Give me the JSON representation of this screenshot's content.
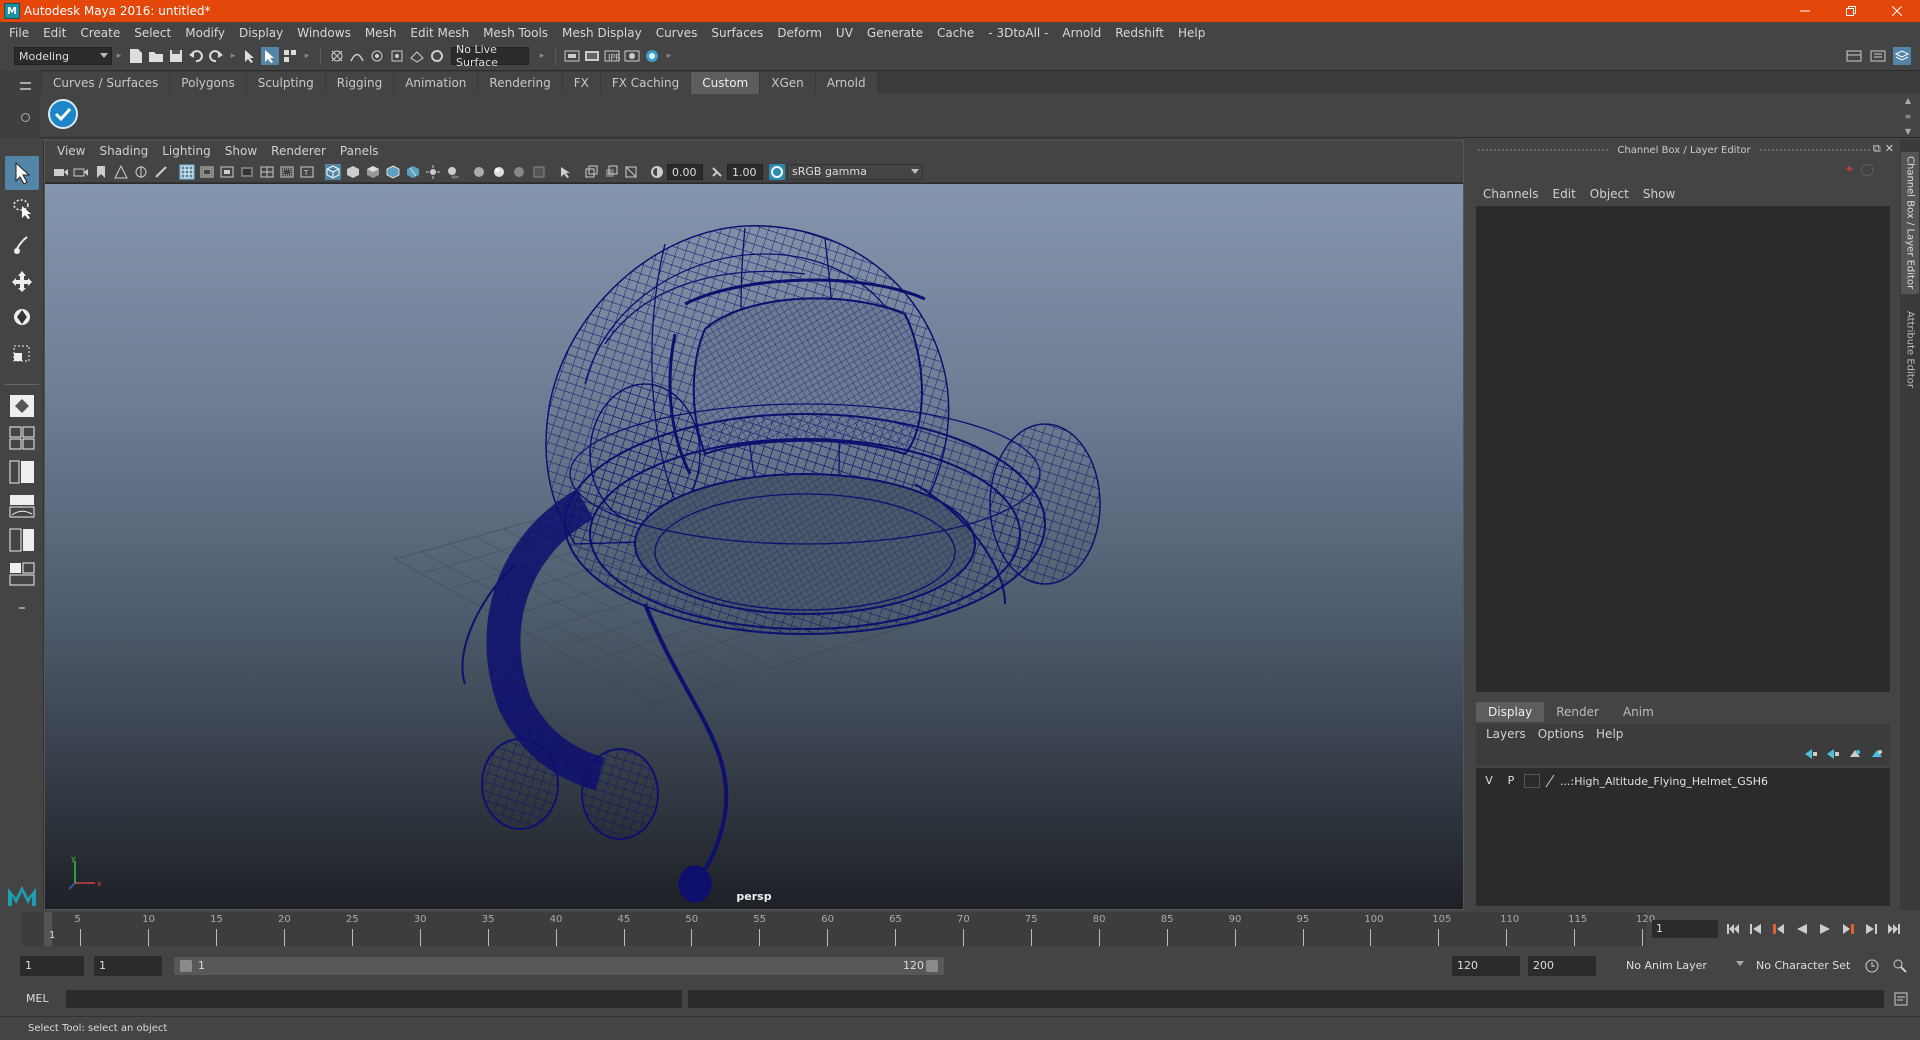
{
  "window": {
    "title": "Autodesk Maya 2016: untitled*",
    "app_icon": "maya-icon",
    "controls": [
      "minimize-icon",
      "restore-icon",
      "close-icon"
    ]
  },
  "menubar": {
    "items": [
      "File",
      "Edit",
      "Create",
      "Select",
      "Modify",
      "Display",
      "Windows",
      "Mesh",
      "Edit Mesh",
      "Mesh Tools",
      "Mesh Display",
      "Curves",
      "Surfaces",
      "Deform",
      "UV",
      "Generate",
      "Cache",
      "- 3DtoAll -",
      "Arnold",
      "Redshift",
      "Help"
    ]
  },
  "statusline": {
    "menuset": "Modeling",
    "live_surface": "No Live Surface"
  },
  "shelf": {
    "tabs": [
      "Curves / Surfaces",
      "Polygons",
      "Sculpting",
      "Rigging",
      "Animation",
      "Rendering",
      "FX",
      "FX Caching",
      "Custom",
      "XGen",
      "Arnold"
    ],
    "active_tab": "Custom",
    "button_icon": "checkmark-icon"
  },
  "viewport": {
    "menu": [
      "View",
      "Shading",
      "Lighting",
      "Show",
      "Renderer",
      "Panels"
    ],
    "exposure": "0.00",
    "gamma": "1.00",
    "color_space": "sRGB gamma",
    "camera": "persp"
  },
  "channelbox": {
    "title": "Channel Box / Layer Editor",
    "menu": [
      "Channels",
      "Edit",
      "Object",
      "Show"
    ],
    "layer_tabs": [
      "Display",
      "Render",
      "Anim"
    ],
    "active_layer_tab": "Display",
    "layer_menu": [
      "Layers",
      "Options",
      "Help"
    ],
    "layers": [
      {
        "v": "V",
        "p": "P",
        "name": "...:High_Altitude_Flying_Helmet_GSH6"
      }
    ]
  },
  "side_tabs": [
    "Channel Box / Layer Editor",
    "Attribute Editor"
  ],
  "timeslider": {
    "ticks": [
      5,
      10,
      15,
      20,
      25,
      30,
      35,
      40,
      45,
      50,
      55,
      60,
      65,
      70,
      75,
      80,
      85,
      90,
      95,
      100,
      105,
      110,
      115,
      120
    ],
    "current_frame_label": "1",
    "current_frame_field": "1"
  },
  "rangeslider": {
    "start_field": "1",
    "playback_start_field": "1",
    "range_start_label": "1",
    "range_end_label": "120",
    "playback_end_field": "120",
    "end_field": "200",
    "anim_layer": "No Anim Layer",
    "character_set": "No Character Set"
  },
  "cmdline": {
    "label": "MEL"
  },
  "helpline": {
    "text": "Select Tool: select an object"
  },
  "colors": {
    "titlebar": "#e5470b",
    "wireframe": "#0f0f6e",
    "accent": "#5285a6"
  }
}
